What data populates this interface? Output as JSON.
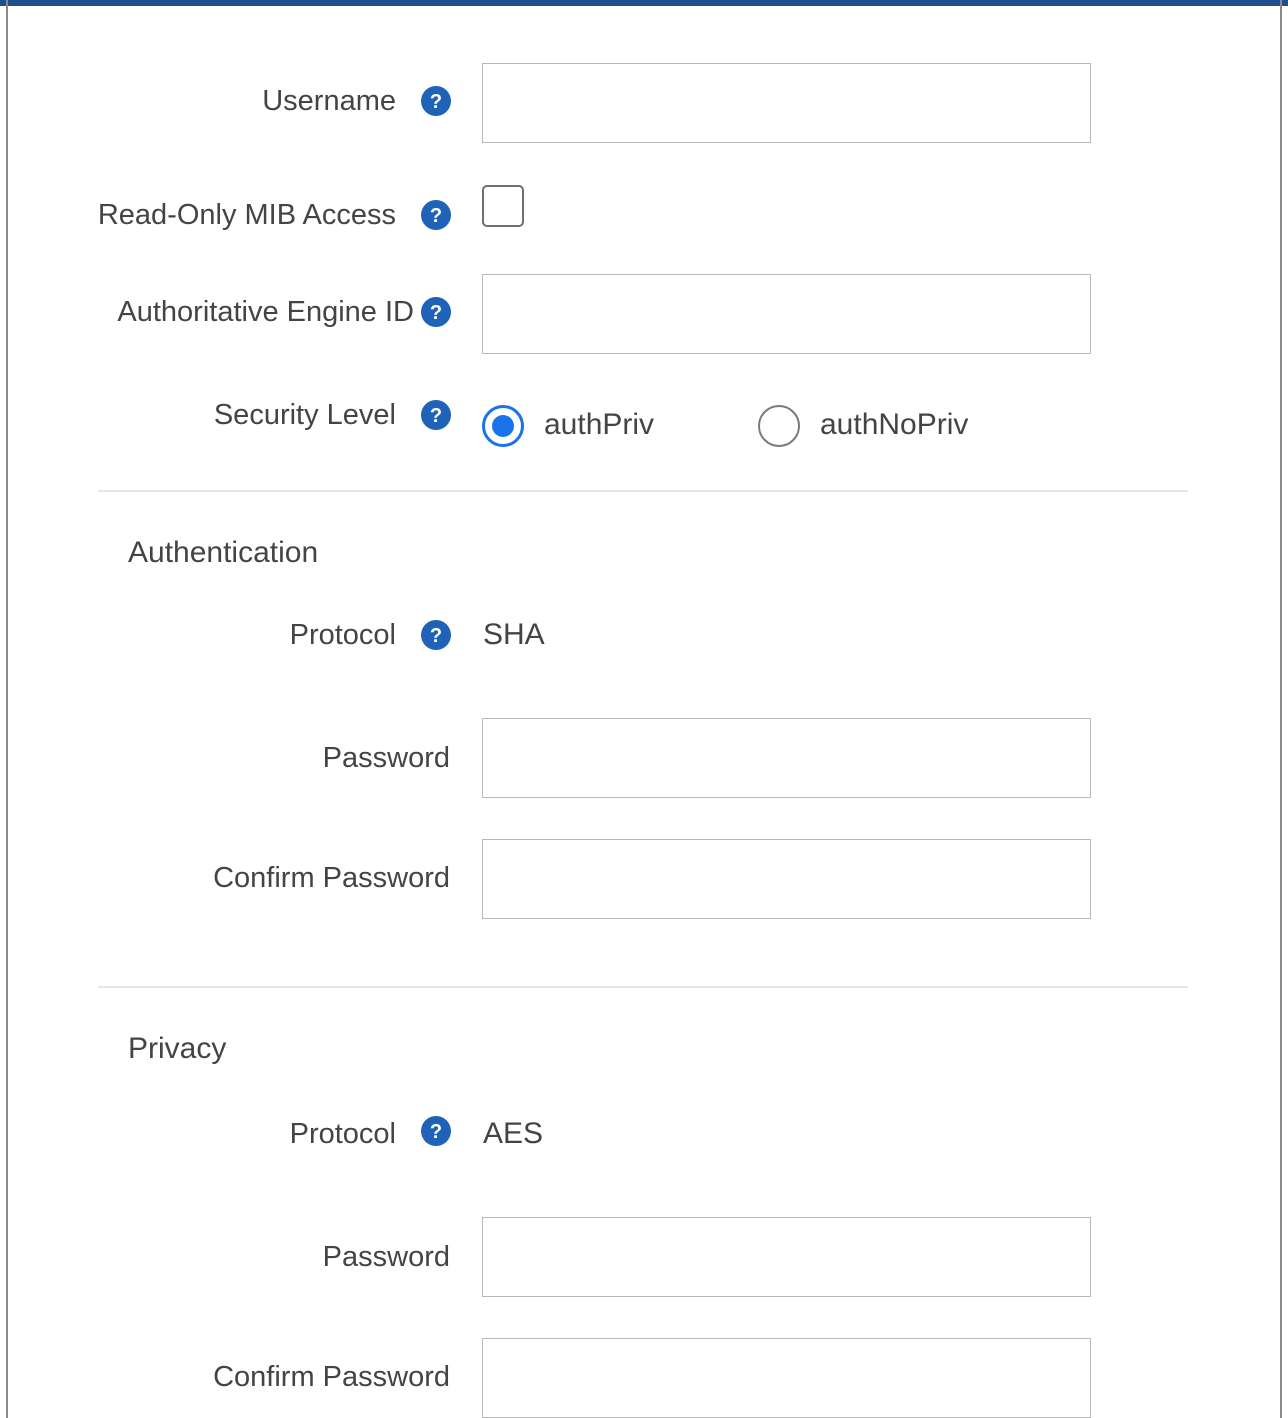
{
  "form": {
    "username": {
      "label": "Username",
      "value": ""
    },
    "read_only_mib": {
      "label": "Read-Only MIB Access",
      "checked": false
    },
    "engine_id": {
      "label": "Authoritative Engine ID",
      "value": ""
    },
    "security_level": {
      "label": "Security Level",
      "options": [
        {
          "label": "authPriv",
          "selected": true
        },
        {
          "label": "authNoPriv",
          "selected": false
        }
      ]
    }
  },
  "authentication": {
    "title": "Authentication",
    "protocol_label": "Protocol",
    "protocol_value": "SHA",
    "password_label": "Password",
    "confirm_password_label": "Confirm Password"
  },
  "privacy": {
    "title": "Privacy",
    "protocol_label": "Protocol",
    "protocol_value": "AES",
    "password_label": "Password",
    "confirm_password_label": "Confirm Password"
  },
  "colors": {
    "accent": "#1a73e8",
    "help_icon": "#1f63b8",
    "top_bar": "#1f4e8c"
  },
  "icons": {
    "help": "question-circle-icon"
  }
}
